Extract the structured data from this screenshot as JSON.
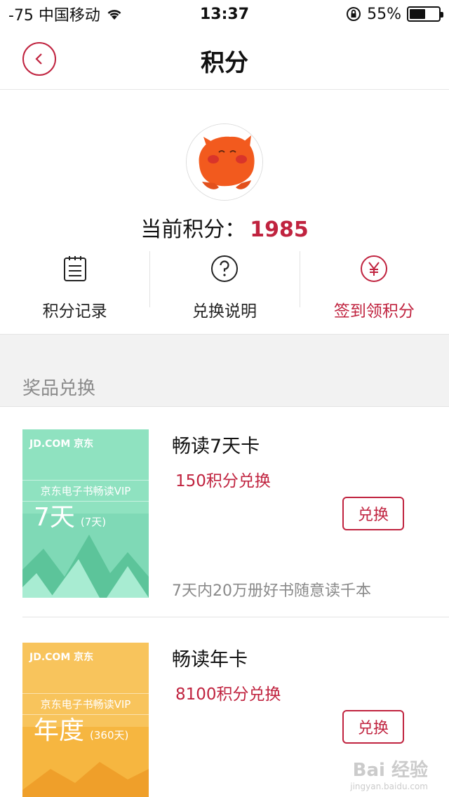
{
  "status_bar": {
    "signal": "-75 中国移动",
    "time": "13:37",
    "battery_text": "55%",
    "battery_level": 0.55
  },
  "nav": {
    "title": "积分",
    "back_icon": "chevron-left-icon"
  },
  "profile": {
    "points_label": "当前积分：",
    "points_value": "1985"
  },
  "actions": [
    {
      "label": "积分记录",
      "icon": "list-icon"
    },
    {
      "label": "兑换说明",
      "icon": "question-icon"
    },
    {
      "label": "签到领积分",
      "icon": "yen-icon",
      "color": "#c0233f"
    }
  ],
  "section": {
    "title": "奖品兑换"
  },
  "products": [
    {
      "name": "畅读7天卡",
      "price": "150积分兑换",
      "button": "兑换",
      "description": "7天内20万册好书随意读千本",
      "thumb": {
        "brand": "JD.COM 京东",
        "title": "京东电子书畅读VIP",
        "big": "7天",
        "small": "(7天)",
        "color": "#7fd9b6"
      }
    },
    {
      "name": "畅读年卡",
      "price": "8100积分兑换",
      "button": "兑换",
      "description": "",
      "thumb": {
        "brand": "JD.COM 京东",
        "title": "京东电子书畅读VIP",
        "big": "年度",
        "small": "(360天)",
        "color": "#f6b640"
      }
    }
  ],
  "watermark": {
    "text": "Bai 经验",
    "sub": "jingyan.baidu.com"
  },
  "colors": {
    "accent": "#c0233f",
    "section_bg": "#f2f2f2"
  }
}
